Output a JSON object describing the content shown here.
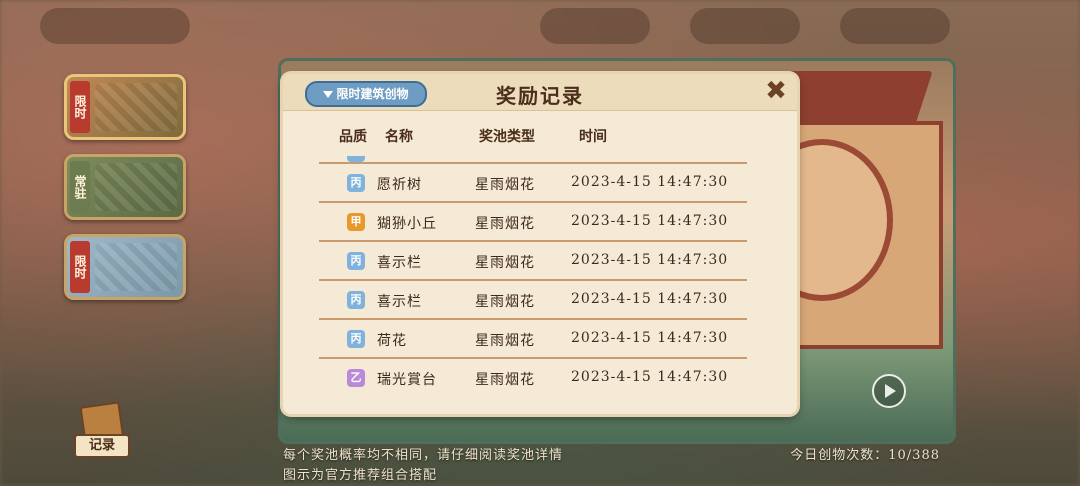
{
  "side_tabs": [
    {
      "tag": "限时",
      "active": true
    },
    {
      "tag": "常驻",
      "active": false
    },
    {
      "tag": "限时",
      "active": false
    }
  ],
  "record_button": {
    "label": "记录"
  },
  "bottom": {
    "line1": "每个奖池概率均不相同，请仔细阅读奖池详情",
    "line2": "图示为官方推荐组合搭配",
    "daily_count": "今日创物次数：10/388"
  },
  "dialog": {
    "filter_label": "限时建筑创物",
    "title": "奖励记录",
    "close_label": "✖",
    "columns": {
      "quality": "品质",
      "name": "名称",
      "pool_type": "奖池类型",
      "time": "时间"
    },
    "rows": [
      {
        "grade": "丙",
        "name": "愿祈树",
        "pool": "星雨烟花",
        "time": "2023-4-15  14:47:30"
      },
      {
        "grade": "甲",
        "name": "猢狲小丘",
        "pool": "星雨烟花",
        "time": "2023-4-15  14:47:30"
      },
      {
        "grade": "丙",
        "name": "喜示栏",
        "pool": "星雨烟花",
        "time": "2023-4-15  14:47:30"
      },
      {
        "grade": "丙",
        "name": "喜示栏",
        "pool": "星雨烟花",
        "time": "2023-4-15  14:47:30"
      },
      {
        "grade": "丙",
        "name": "荷花",
        "pool": "星雨烟花",
        "time": "2023-4-15  14:47:30"
      },
      {
        "grade": "乙",
        "name": "瑞光賞台",
        "pool": "星雨烟花",
        "time": "2023-4-15  14:47:30"
      }
    ]
  },
  "colors": {
    "grade_bing": "#7fb2dc",
    "grade_jia": "#e79a2b",
    "grade_yi": "#b98ad8"
  }
}
